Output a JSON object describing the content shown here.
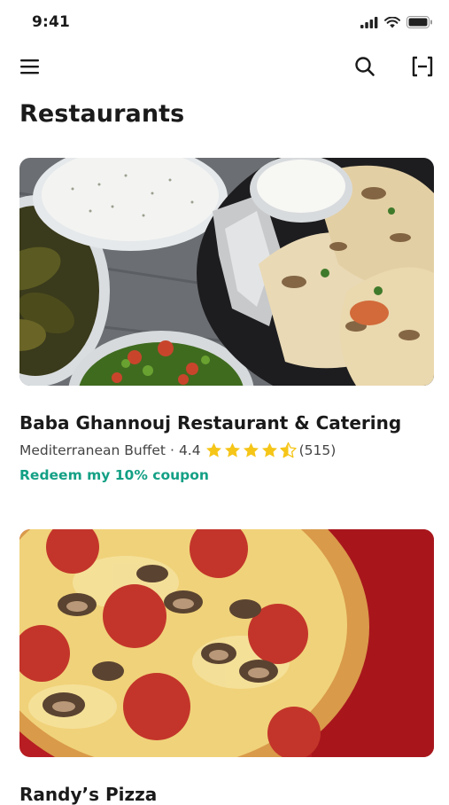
{
  "status_bar": {
    "time": "9:41"
  },
  "nav": {
    "menu_icon": "menu-icon",
    "search_icon": "search-icon",
    "scan_icon": "scan-icon"
  },
  "page": {
    "title": "Restaurants"
  },
  "restaurants": [
    {
      "name": "Baba Ghannouj Restaurant & Catering",
      "cuisine": "Mediterranean Buffet",
      "separator": "·",
      "rating": "4.4",
      "rating_value": 4.4,
      "review_count": "(515)",
      "coupon": "Redeem my 10% coupon"
    },
    {
      "name": "Randy’s Pizza"
    }
  ],
  "colors": {
    "accent": "#14a085",
    "star": "#f5c518",
    "text": "#1a1a1a"
  }
}
